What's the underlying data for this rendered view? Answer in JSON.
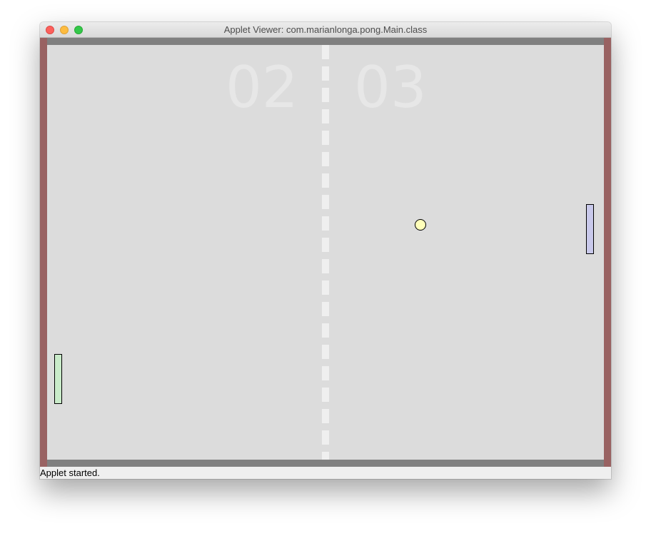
{
  "window": {
    "title": "Applet Viewer: com.marianlonga.pong.Main.class"
  },
  "game": {
    "score_left": "02",
    "score_right": "03",
    "colors": {
      "field": "#dcdcdc",
      "side_walls": "#996262",
      "top_bottom_walls": "#808080",
      "net": "#efefef",
      "score_text": "#e7e7e7",
      "left_paddle": "#c9ebc9",
      "right_paddle": "#c9c9eb",
      "ball": "#ffffb9"
    }
  },
  "status": {
    "text": "Applet started."
  }
}
